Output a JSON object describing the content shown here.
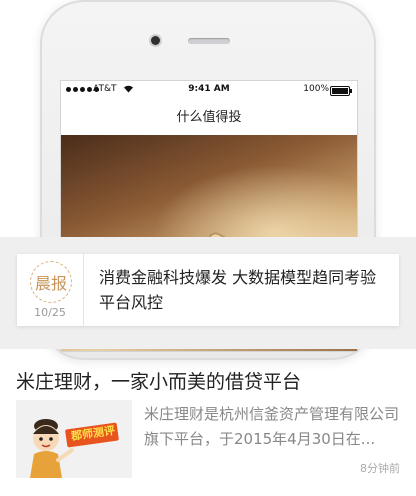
{
  "status_bar": {
    "carrier": "AT&T",
    "time": "9:41 AM",
    "battery": "100%"
  },
  "nav": {
    "title": "什么值得投"
  },
  "news": {
    "badge_label": "晨报",
    "badge_date": "10/25",
    "text": "消费金融科技爆发 大数据模型趋同考验平台风控"
  },
  "article": {
    "title": "米庄理财，一家小而美的借贷平台",
    "thumb_label": "郡师测评",
    "summary": "米庄理财是杭州信釜资产管理有限公司旗下平台，于2015年4月30日在...",
    "time": "8分钟前"
  },
  "colors": {
    "seal": "#c8955a",
    "thumb_banner": "#e8541e"
  }
}
